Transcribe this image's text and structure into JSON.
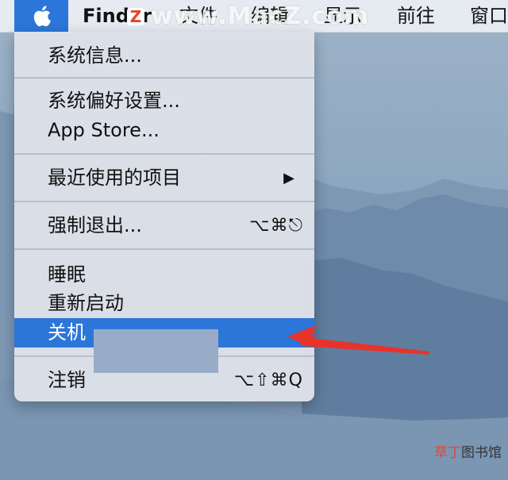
{
  "menubar": {
    "apple_icon": "apple-icon",
    "finder": "Finder",
    "file": "文件",
    "edit": "编辑",
    "view": "显示",
    "go": "前往",
    "window": "窗口"
  },
  "watermark": {
    "text": "www.MacZ.com",
    "logo_letter": "Z"
  },
  "apple_menu": {
    "system_info": "系统信息...",
    "system_prefs": "系统偏好设置...",
    "app_store": "App Store...",
    "recent_items": "最近使用的项目",
    "recent_items_arrow": "▶",
    "force_quit": "强制退出...",
    "force_quit_shortcut": "⌥⌘⎋",
    "sleep": "睡眠",
    "restart": "重新启动",
    "shutdown": "关机",
    "logout": "注销",
    "logout_shortcut": "⌥⇧⌘Q"
  },
  "credit": {
    "highlight": "草丁",
    "rest": "图书馆"
  },
  "colors": {
    "highlight": "#2c76d9",
    "arrow": "#e8332a"
  }
}
